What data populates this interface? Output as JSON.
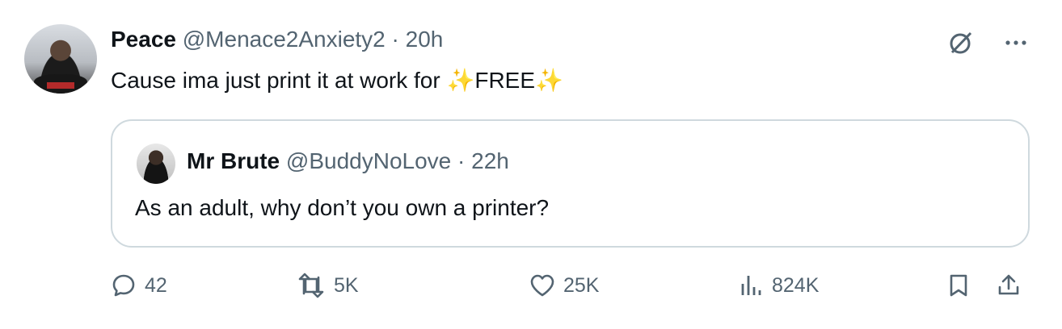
{
  "tweet": {
    "name": "Peace",
    "handle": "@Menace2Anxiety2",
    "separator": "·",
    "time": "20h",
    "text": "Cause ima just print it at work for ",
    "sparkle": "✨",
    "free": "FREE"
  },
  "quote": {
    "name": "Mr Brute",
    "handle": "@BuddyNoLove",
    "separator": "·",
    "time": "22h",
    "text": "As an adult, why don’t you own a printer?"
  },
  "actions": {
    "replies": "42",
    "reposts": "5K",
    "likes": "25K",
    "views": "824K"
  },
  "icons": {
    "grok": "grok-icon",
    "more": "more-icon",
    "reply": "reply-icon",
    "repost": "repost-icon",
    "like": "heart-icon",
    "views": "views-icon",
    "bookmark": "bookmark-icon",
    "share": "share-icon"
  },
  "colors": {
    "text": "#0f1419",
    "muted": "#536471",
    "border": "#cfd9de",
    "sparkle": "#f4b400"
  }
}
